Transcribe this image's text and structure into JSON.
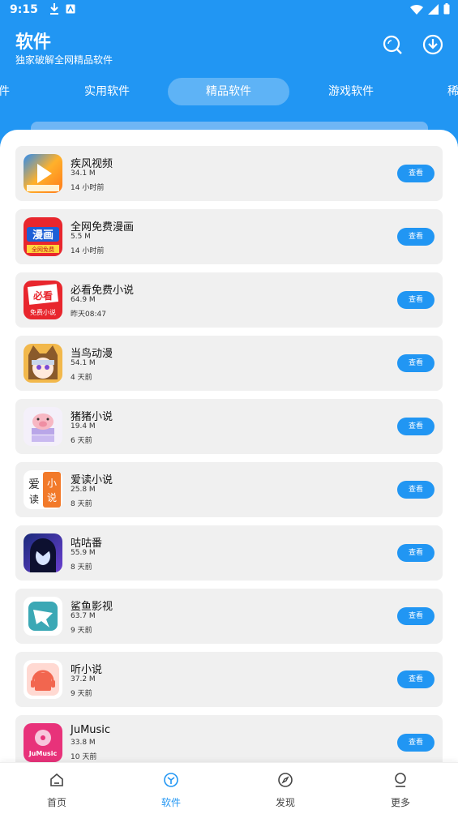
{
  "status_bar": {
    "time": "9:15"
  },
  "header": {
    "title": "软件",
    "subtitle": "独家破解全网精品软件"
  },
  "tabs": [
    {
      "label": "件"
    },
    {
      "label": "实用软件"
    },
    {
      "label": "精品软件",
      "active": true
    },
    {
      "label": "游戏软件"
    },
    {
      "label": "稀"
    }
  ],
  "apps": [
    {
      "name": "疾风视频",
      "size": "34.1 M",
      "time": "14 小时前",
      "button": "查看",
      "icon": "play-video-icon"
    },
    {
      "name": "全网免费漫画",
      "size": "5.5 M",
      "time": "14 小时前",
      "button": "查看",
      "icon": "comic-icon"
    },
    {
      "name": "必看免费小说",
      "size": "64.9 M",
      "time": "昨天08:47",
      "button": "查看",
      "icon": "novel-icon"
    },
    {
      "name": "当鸟动漫",
      "size": "54.1 M",
      "time": "4 天前",
      "button": "查看",
      "icon": "anime-girl-icon"
    },
    {
      "name": "猪猪小说",
      "size": "19.4 M",
      "time": "6 天前",
      "button": "查看",
      "icon": "pig-icon"
    },
    {
      "name": "爱读小说",
      "size": "25.8 M",
      "time": "8 天前",
      "button": "查看",
      "icon": "aidu-icon"
    },
    {
      "name": "咕咕番",
      "size": "55.9 M",
      "time": "8 天前",
      "button": "查看",
      "icon": "anime-boy-icon"
    },
    {
      "name": "鲨鱼影视",
      "size": "63.7 M",
      "time": "9 天前",
      "button": "查看",
      "icon": "shark-icon"
    },
    {
      "name": "听小说",
      "size": "37.2 M",
      "time": "9 天前",
      "button": "查看",
      "icon": "headphones-book-icon"
    },
    {
      "name": "JuMusic",
      "size": "33.8 M",
      "time": "10 天前",
      "button": "查看",
      "icon": "music-disc-icon"
    }
  ],
  "app_icon_text": {
    "jifeng": "疾风视频",
    "comic": "漫画",
    "comic_sub": "全网免费",
    "bikan": "必看",
    "bikan_sub": "免费小说",
    "aidu_1": "爱",
    "aidu_2": "读",
    "aidu_3": "小",
    "aidu_4": "说",
    "jumusic": "JuMusic"
  },
  "bottom_nav": [
    {
      "label": "首页",
      "icon": "home-icon"
    },
    {
      "label": "软件",
      "icon": "software-cube-icon",
      "active": true
    },
    {
      "label": "发现",
      "icon": "compass-icon"
    },
    {
      "label": "更多",
      "icon": "person-icon"
    }
  ],
  "colors": {
    "primary": "#2196F3",
    "card_bg": "#f0f0f0",
    "panel_bg": "#ffffff"
  }
}
